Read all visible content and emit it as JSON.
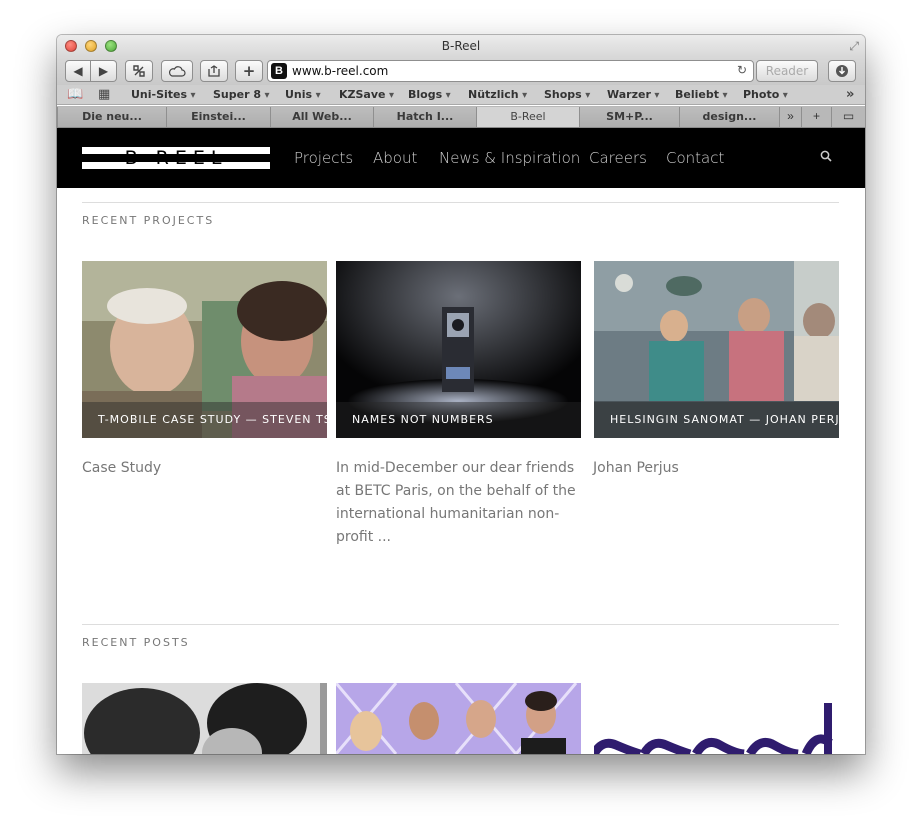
{
  "window": {
    "title": "B-Reel"
  },
  "toolbar": {
    "back_glyph": "◀",
    "forward_glyph": "▶",
    "url": "www.b-reel.com",
    "site_icon_letter": "B",
    "reload_glyph": "↻",
    "reader_label": "Reader",
    "add_glyph": "+"
  },
  "bookmarks": [
    "Uni-Sites",
    "Super 8",
    "Unis",
    "KZSave",
    "Blogs",
    "Nützlich",
    "Shops",
    "Warzer",
    "Beliebt",
    "Photo"
  ],
  "tabs": [
    "Die neu...",
    "Einstei...",
    "All Web...",
    "Hatch I...",
    "B-Reel",
    "SM+P...",
    "design..."
  ],
  "active_tab_index": 4,
  "site": {
    "logo": "B REEL",
    "nav": [
      "Projects",
      "About",
      "News & Inspiration",
      "Careers",
      "Contact"
    ]
  },
  "recent_projects": {
    "title": "RECENT PROJECTS",
    "items": [
      {
        "caption": "T-MOBILE CASE STUDY — STEVEN TS",
        "description": "Case Study"
      },
      {
        "caption": "NAMES NOT NUMBERS",
        "description": "In mid-December our dear friends at BETC Paris, on the behalf of the international humanitarian non-profit ..."
      },
      {
        "caption": "HELSINGIN SANOMAT — JOHAN PERJUS",
        "description": "Johan Perjus"
      }
    ]
  },
  "recent_posts": {
    "title": "RECENT POSTS"
  },
  "colors": {
    "header_bg": "#000000",
    "nav_text": "#cfcfcf",
    "body_text": "#777777"
  }
}
